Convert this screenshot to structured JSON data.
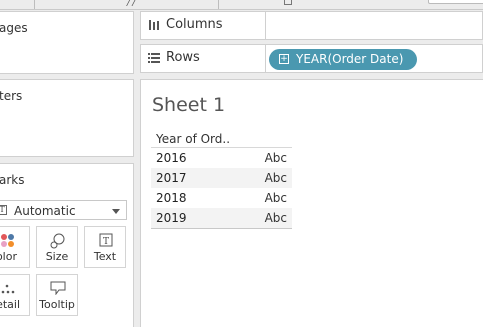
{
  "left_panels": {
    "pages_title": "ages",
    "filters_title": "ters",
    "marks_title": "arks"
  },
  "marks": {
    "type_selected": "Automatic",
    "cards": [
      {
        "label": "olor",
        "icon": "color-icon"
      },
      {
        "label": "Size",
        "icon": "size-icon"
      },
      {
        "label": "Text",
        "icon": "text-icon"
      },
      {
        "label": "etail",
        "icon": "detail-icon"
      },
      {
        "label": "Tooltip",
        "icon": "tooltip-icon"
      }
    ]
  },
  "shelves": {
    "columns_label": "Columns",
    "rows_label": "Rows",
    "rows_pill": "YEAR(Order Date)"
  },
  "sheet": {
    "title": "Sheet 1",
    "column_header": "Year of Ord..",
    "rows": [
      {
        "year": "2016",
        "value": "Abc"
      },
      {
        "year": "2017",
        "value": "Abc"
      },
      {
        "year": "2018",
        "value": "Abc"
      },
      {
        "year": "2019",
        "value": "Abc"
      }
    ]
  },
  "colors": {
    "pill": "#4a98b0",
    "dot_red": "#e15759",
    "dot_blue": "#4e79a7",
    "dot_pink": "#e8a1c5",
    "dot_orange": "#f28e2b"
  }
}
